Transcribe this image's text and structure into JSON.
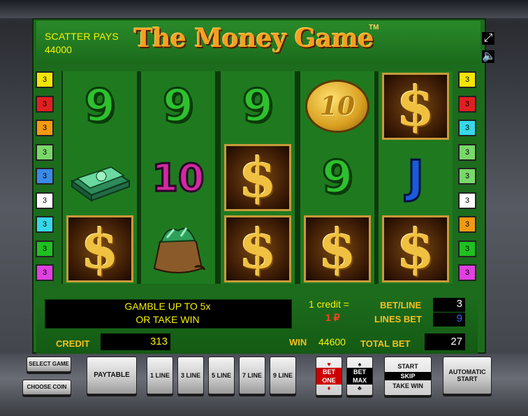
{
  "header": {
    "scatter_label": "SCATTER PAYS",
    "scatter_value": "44000",
    "title": "The Money Game",
    "trademark": "TM"
  },
  "side_icons": [
    "fullscreen-icon",
    "sound-icon"
  ],
  "line_indicators_left": [
    {
      "label": "3",
      "color": "#f4e600"
    },
    {
      "label": "3",
      "color": "#e02020"
    },
    {
      "label": "3",
      "color": "#f49a10"
    },
    {
      "label": "3",
      "color": "#7ad86a"
    },
    {
      "label": "3",
      "color": "#3a8ae8"
    },
    {
      "label": "3",
      "color": "#ffffff"
    },
    {
      "label": "3",
      "color": "#36d8e8"
    },
    {
      "label": "3",
      "color": "#20c020"
    },
    {
      "label": "3",
      "color": "#e040e0"
    }
  ],
  "line_indicators_right": [
    {
      "label": "3",
      "color": "#f4e600"
    },
    {
      "label": "3",
      "color": "#e02020"
    },
    {
      "label": "3",
      "color": "#36d8e8"
    },
    {
      "label": "3",
      "color": "#7ad86a"
    },
    {
      "label": "3",
      "color": "#7ad86a"
    },
    {
      "label": "3",
      "color": "#ffffff"
    },
    {
      "label": "3",
      "color": "#f49a10"
    },
    {
      "label": "3",
      "color": "#20c020"
    },
    {
      "label": "3",
      "color": "#e040e0"
    }
  ],
  "reels": [
    [
      "9",
      "cash-stack",
      "$"
    ],
    [
      "9",
      "10",
      "money-bag"
    ],
    [
      "9",
      "$",
      "$"
    ],
    [
      "10",
      "9",
      "$"
    ],
    [
      "$",
      "J",
      "$"
    ]
  ],
  "info": {
    "gamble_line1": "GAMBLE UP TO 5x",
    "gamble_line2": "OR TAKE WIN",
    "credit_rate_label": "1 credit =",
    "credit_rate_value": "1 ₽",
    "bet_line_label": "BET/LINE",
    "bet_line_value": "3",
    "lines_bet_label": "LINES BET",
    "lines_bet_value": "9",
    "credit_label": "CREDIT",
    "credit_value": "313",
    "win_label": "WIN",
    "win_value": "44600",
    "total_bet_label": "TOTAL BET",
    "total_bet_value": "27"
  },
  "buttons": {
    "select_game": "SELECT GAME",
    "choose_coin": "CHOOSE COIN",
    "paytable": "PAYTABLE",
    "line1": "1 LINE",
    "line3": "3 LINE",
    "line5": "5 LINE",
    "line7": "7 LINE",
    "line9": "9 LINE",
    "bet_one_top": "BET",
    "bet_one_bottom": "ONE",
    "bet_max_top": "BET",
    "bet_max_bottom": "MAX",
    "start": "START",
    "skip": "SKIP",
    "take_win": "TAKE WIN",
    "automatic_start": "AUTOMATIC START"
  },
  "colors": {
    "screen_green": "#1d6b1d",
    "title_orange": "#f5a020",
    "info_yellow": "#f4f200"
  }
}
